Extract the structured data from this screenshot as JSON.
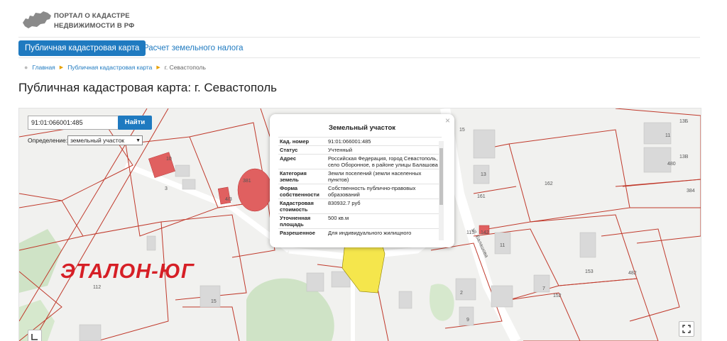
{
  "header": {
    "logo_line1": "ПОРТАЛ О КАДАСТРЕ",
    "logo_line2": "НЕДВИЖИМОСТИ В РФ",
    "logo_icon": "russia-map-icon"
  },
  "nav": {
    "active_tab": "Публичная кадастровая карта",
    "second_tab": "Расчет земельного налога"
  },
  "breadcrumb": {
    "home": "Главная",
    "section": "Публичная кадастровая карта",
    "current": "г. Севастополь"
  },
  "page_title": "Публичная кадастровая карта: г. Севастополь",
  "map": {
    "search_value": "91:01:066001:485",
    "search_button": "Найти",
    "definition_label": "Определение:",
    "definition_value": "земельный участок",
    "watermark": "ЭТАЛОН-ЮГ",
    "street_label": "ул. Балашова",
    "parcel_labels": [
      "15",
      "10",
      "3",
      "381",
      "13",
      "161",
      "162",
      "13Б",
      "11",
      "13В",
      "480",
      "384",
      "11",
      "153",
      "482",
      "152",
      "7",
      "2",
      "9",
      "15",
      "112",
      "115",
      "142",
      "4/3"
    ],
    "popup": {
      "title": "Земельный участок",
      "close": "×",
      "rows": [
        {
          "key": "Кад. номер",
          "value": "91:01:066001:485"
        },
        {
          "key": "Статус",
          "value": "Учтенный"
        },
        {
          "key": "Адрес",
          "value": "Российская Федерация, город Севастополь, село Оборонное, в районе улицы Балашова"
        },
        {
          "key": "Категория земель",
          "value": "Земли поселений (земли населенных пунктов)"
        },
        {
          "key": "Форма собственности",
          "value": "Собственность публично-правовых образований"
        },
        {
          "key": "Кадастровая стоимость",
          "value": "830932.7 руб"
        },
        {
          "key": "Уточненная площадь",
          "value": "500 кв.м"
        },
        {
          "key": "Разрешенное",
          "value": "Для индивидуального жилищного"
        }
      ]
    }
  },
  "colors": {
    "accent": "#1f7ac0",
    "parcel_border": "#c0392b",
    "selected_parcel": "#f5e64c",
    "watermark": "#d61f26"
  }
}
